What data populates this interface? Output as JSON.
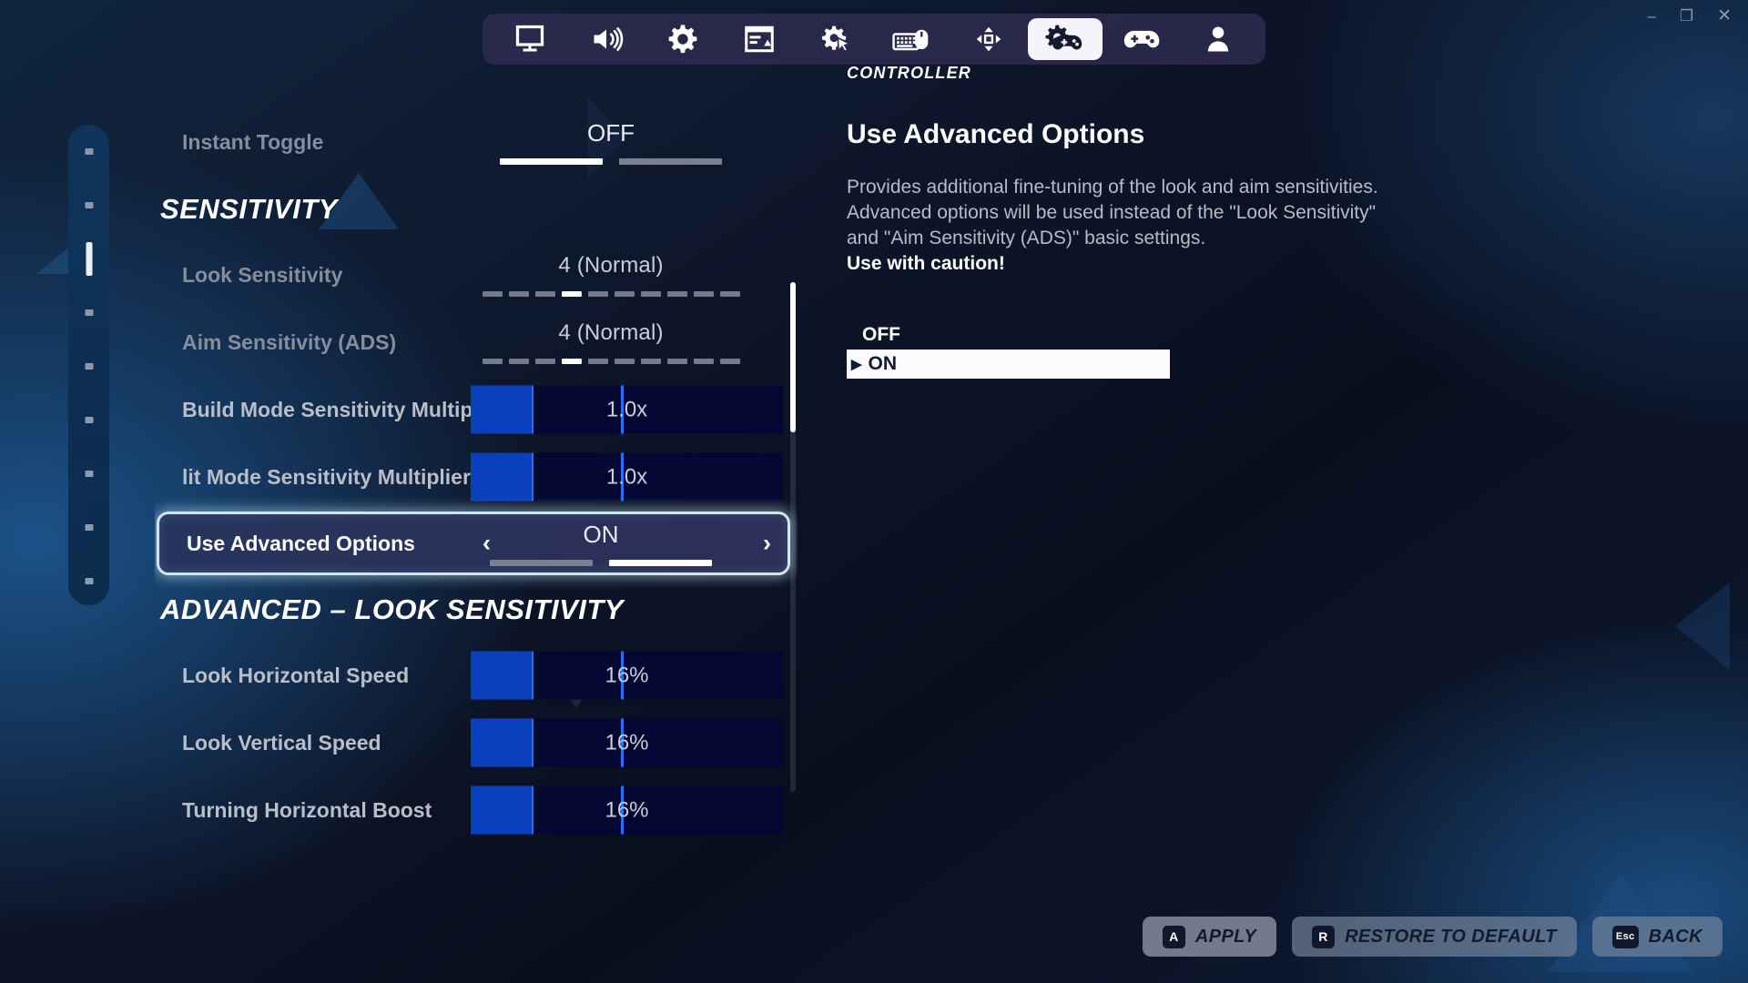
{
  "window": {
    "minimize_label": "–",
    "maximize_label": "❐",
    "close_label": "✕"
  },
  "tabbar": {
    "tabs": [
      {
        "name": "video-tab",
        "icon": "monitor-icon",
        "active": false
      },
      {
        "name": "audio-tab",
        "icon": "speaker-icon",
        "active": false
      },
      {
        "name": "game-tab",
        "icon": "gear-icon",
        "active": false
      },
      {
        "name": "hud-tab",
        "icon": "hud-layout-icon",
        "active": false
      },
      {
        "name": "accessibility-tab",
        "icon": "gear-cursor-icon",
        "active": false
      },
      {
        "name": "keyboard-mouse-tab",
        "icon": "keyboard-mouse-icon",
        "active": false
      },
      {
        "name": "dpad-tab",
        "icon": "dpad-icon",
        "active": false
      },
      {
        "name": "controller-settings-tab",
        "icon": "gamepad-gear-icon",
        "active": true
      },
      {
        "name": "controller-bindings-tab",
        "icon": "gamepad-icon",
        "active": false
      },
      {
        "name": "account-tab",
        "icon": "person-icon",
        "active": false
      }
    ]
  },
  "rail": {
    "total": 9,
    "active_index": 2
  },
  "settings": {
    "rows": [
      {
        "type": "duo",
        "name": "instant-toggle",
        "label": "Instant Toggle",
        "label_dim": true,
        "value": "OFF",
        "left_on": true,
        "right_on": false
      },
      {
        "type": "header",
        "name": "section-sensitivity",
        "label": "SENSITIVITY"
      },
      {
        "type": "segments",
        "name": "look-sensitivity",
        "label": "Look Sensitivity",
        "label_dim": true,
        "value": "4 (Normal)",
        "segments": 10,
        "active_segment": 3
      },
      {
        "type": "segments",
        "name": "aim-sensitivity-ads",
        "label": "Aim Sensitivity (ADS)",
        "label_dim": true,
        "value": "4 (Normal)",
        "segments": 10,
        "active_segment": 3
      },
      {
        "type": "bar",
        "name": "build-mode-sensitivity-multiplier",
        "label": "Build Mode Sensitivity Multip",
        "value": "1.0x",
        "fill_percent": 20,
        "marker_percent": 48
      },
      {
        "type": "bar",
        "name": "edit-mode-sensitivity-multiplier",
        "label": "lit Mode Sensitivity Multiplier",
        "value": "1.0x",
        "fill_percent": 20,
        "marker_percent": 48
      },
      {
        "type": "selected",
        "name": "use-advanced-options",
        "label": "Use Advanced Options",
        "value": "ON",
        "arrow_left": "‹",
        "arrow_right": "›",
        "left_on": false,
        "right_on": true
      },
      {
        "type": "header",
        "name": "section-advanced-look-sensitivity",
        "label": "ADVANCED – LOOK SENSITIVITY"
      },
      {
        "type": "bar",
        "name": "look-horizontal-speed",
        "label": "Look Horizontal Speed",
        "value": "16%",
        "fill_percent": 20,
        "marker_percent": 48
      },
      {
        "type": "bar",
        "name": "look-vertical-speed",
        "label": "Look Vertical Speed",
        "value": "16%",
        "fill_percent": 20,
        "marker_percent": 48
      },
      {
        "type": "bar",
        "name": "turning-horizontal-boost",
        "label": "Turning Horizontal Boost",
        "value": "16%",
        "fill_percent": 20,
        "marker_percent": 48
      }
    ]
  },
  "detail": {
    "kicker": "CONTROLLER",
    "title": "Use Advanced Options",
    "body": "Provides additional fine-tuning of the look and aim sensitivities.  Advanced options will be used instead of the \"Look Sensitivity\" and \"Aim Sensitivity (ADS)\" basic settings.",
    "warning": "Use with caution!",
    "options": [
      {
        "label": "OFF",
        "selected": false
      },
      {
        "label": "ON",
        "selected": true,
        "caret": "▶"
      }
    ]
  },
  "actions": [
    {
      "name": "apply-button",
      "key": "A",
      "label": "APPLY"
    },
    {
      "name": "restore-to-default-button",
      "key": "R",
      "label": "RESTORE TO DEFAULT"
    },
    {
      "name": "back-button",
      "key": "Esc",
      "label": "BACK"
    }
  ],
  "colors": {
    "accent_blue": "#0a3fbe",
    "marker_blue": "#2b6dff",
    "selected_glow": "#cfe6ef",
    "panel_bg": "#050733"
  }
}
